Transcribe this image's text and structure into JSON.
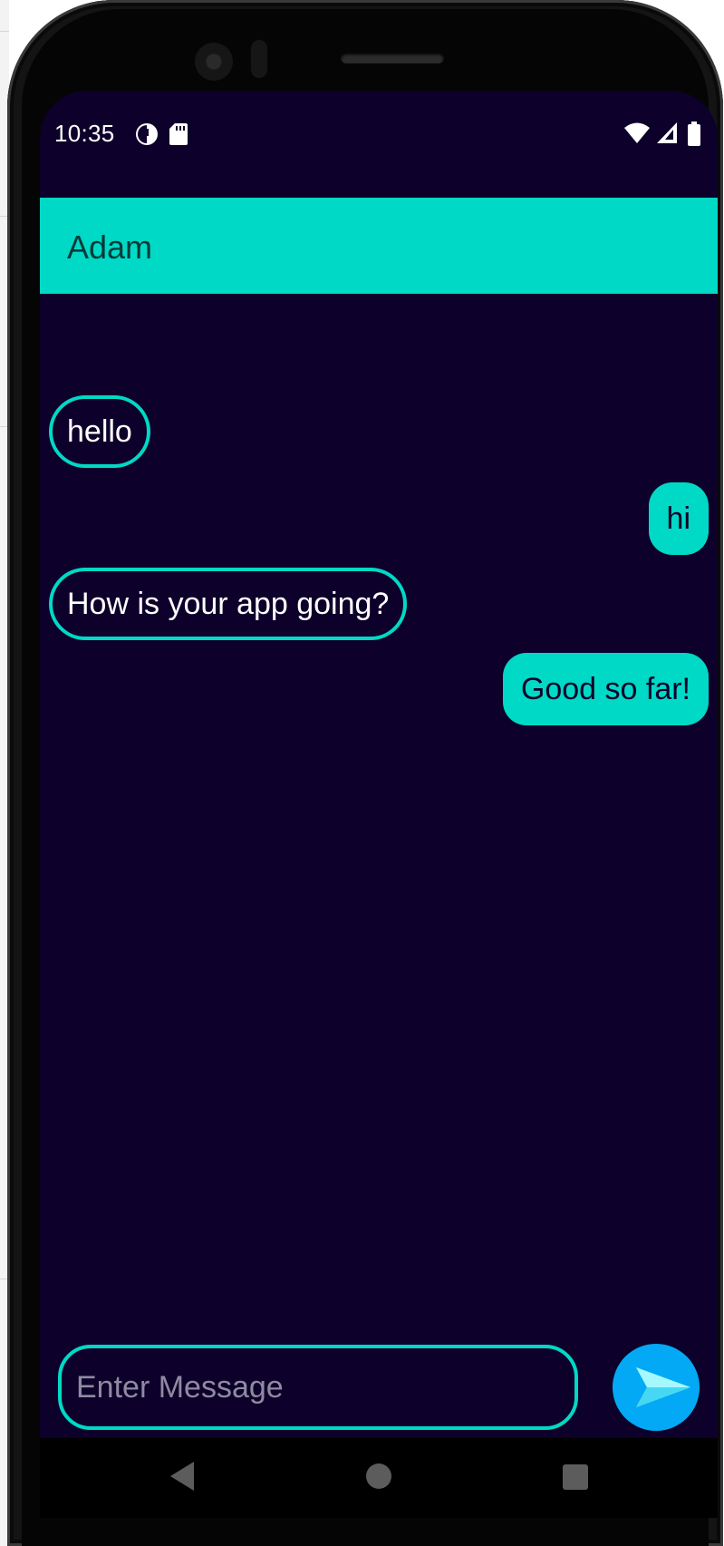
{
  "status_bar": {
    "time": "10:35",
    "left_icons": [
      "data-saver-icon",
      "sd-card-icon"
    ],
    "right_icons": [
      "wifi-icon",
      "cellular-signal-icon",
      "battery-icon"
    ]
  },
  "app_bar": {
    "title": "Adam"
  },
  "messages": [
    {
      "text": "hello",
      "direction": "incoming"
    },
    {
      "text": "hi",
      "direction": "outgoing"
    },
    {
      "text": "How is your app going?",
      "direction": "incoming"
    },
    {
      "text": "Good so far!",
      "direction": "outgoing"
    }
  ],
  "composer": {
    "placeholder": "Enter Message",
    "value": "",
    "send_icon": "send-icon"
  },
  "nav_bar": {
    "icons": [
      "back-icon",
      "home-icon",
      "recents-icon"
    ]
  },
  "colors": {
    "screen_background": "#0d002a",
    "accent": "#00d9c5",
    "title_text": "#003a39",
    "send_button": "#03a9f4",
    "send_arrow": "#7ff3ff"
  }
}
